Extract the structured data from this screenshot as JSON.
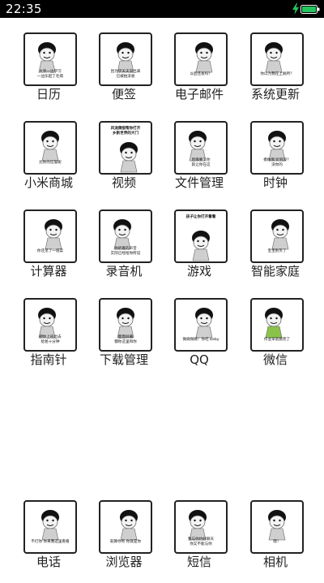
{
  "status_bar": {
    "time": "22:35",
    "charge_icon": "lightning-icon",
    "battery_icon": "battery-icon",
    "battery_color": "#22c55e"
  },
  "apps": [
    {
      "label": "日历",
      "caption": "大爷一边学习\n一边乐起了毛病"
    },
    {
      "label": "便签",
      "caption": "因为学天天没出来\n已被拍没收"
    },
    {
      "label": "电子邮件",
      "caption": "以后还发吗？"
    },
    {
      "label": "系统更新",
      "caption": "你以为我在上厕所？"
    },
    {
      "label": "小米商城",
      "caption": "比你的信誉呢"
    },
    {
      "label": "视频",
      "caption": "风流倜傥帮你打开\n乡新世界的大门"
    },
    {
      "label": "文件管理",
      "caption": "后悔要了你\n就让你在这"
    },
    {
      "label": "时钟",
      "caption": "摸你啊 听到没？\n没你的"
    },
    {
      "label": "计算器",
      "caption": "你还见了一道菜"
    },
    {
      "label": "录音机",
      "caption": "你听着的声音\n实际已经给你所说"
    },
    {
      "label": "游戏",
      "caption": "孩子让你打开看看"
    },
    {
      "label": "智能家庭",
      "caption": "宝宝别笑了"
    },
    {
      "label": "指南针",
      "caption": "把你上班出去\n给爸十分钟"
    },
    {
      "label": "下载管理",
      "caption": "面面屏幕\n都你这里和你"
    },
    {
      "label": "QQ",
      "caption": "微微微微！你吃 baby"
    },
    {
      "label": "微信",
      "caption": "作业早就搞完了"
    },
    {
      "label": "电话",
      "caption": "不打你 你来我这里看看"
    },
    {
      "label": "浏览器",
      "caption": "就算你有 你就是你"
    },
    {
      "label": "短信",
      "caption": "我与你约好聊天\n你又不能与你"
    },
    {
      "label": "相机",
      "caption": "嗯！"
    }
  ]
}
